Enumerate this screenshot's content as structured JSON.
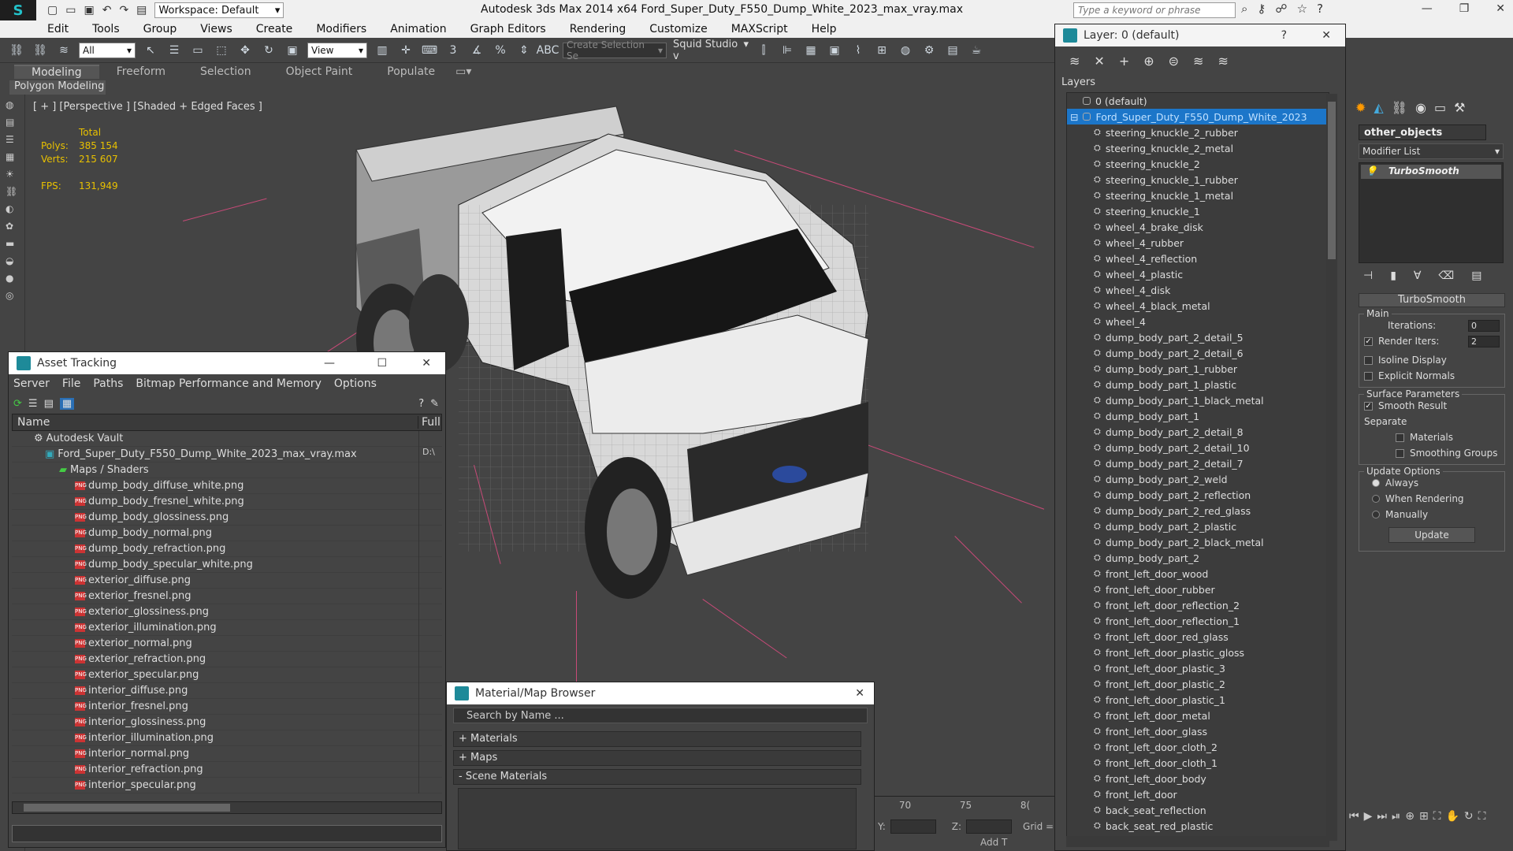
{
  "app": {
    "title": "Autodesk 3ds Max  2014 x64     Ford_Super_Duty_F550_Dump_White_2023_max_vray.max",
    "workspace": "Workspace: Default",
    "search_placeholder": "Type a keyword or phrase"
  },
  "menu": [
    "Edit",
    "Tools",
    "Group",
    "Views",
    "Create",
    "Modifiers",
    "Animation",
    "Graph Editors",
    "Rendering",
    "Customize",
    "MAXScript",
    "Help"
  ],
  "toolbar": {
    "filter": "All",
    "ref_coord": "View",
    "selection_set": "Create Selection Se",
    "squid": "Squid Studio v"
  },
  "ribbon": {
    "tabs": [
      "Modeling",
      "Freeform",
      "Selection",
      "Object Paint",
      "Populate"
    ],
    "active": "Modeling",
    "subpanel": "Polygon Modeling"
  },
  "viewport": {
    "label": "[ + ] [Perspective ] [Shaded + Edged Faces ]",
    "stats": {
      "header": "Total",
      "polys_label": "Polys:",
      "polys": "385 154",
      "verts_label": "Verts:",
      "verts": "215 607",
      "fps_label": "FPS:",
      "fps": "131,949"
    }
  },
  "asset": {
    "title": "Asset Tracking",
    "menu": [
      "Server",
      "File",
      "Paths",
      "Bitmap Performance and Memory",
      "Options"
    ],
    "col_name": "Name",
    "col_full": "Full",
    "vault": "Autodesk Vault",
    "file": "Ford_Super_Duty_F550_Dump_White_2023_max_vray.max",
    "file_path": "D:\\",
    "maps": "Maps / Shaders",
    "textures": [
      "dump_body_diffuse_white.png",
      "dump_body_fresnel_white.png",
      "dump_body_glossiness.png",
      "dump_body_normal.png",
      "dump_body_refraction.png",
      "dump_body_specular_white.png",
      "exterior_diffuse.png",
      "exterior_fresnel.png",
      "exterior_glossiness.png",
      "exterior_illumination.png",
      "exterior_normal.png",
      "exterior_refraction.png",
      "exterior_specular.png",
      "interior_diffuse.png",
      "interior_fresnel.png",
      "interior_glossiness.png",
      "interior_illumination.png",
      "interior_normal.png",
      "interior_refraction.png",
      "interior_specular.png"
    ]
  },
  "layer": {
    "title": "Layer: 0 (default)",
    "header": "Layers",
    "default": "0 (default)",
    "selected": "Ford_Super_Duty_F550_Dump_White_2023",
    "items": [
      "steering_knuckle_2_rubber",
      "steering_knuckle_2_metal",
      "steering_knuckle_2",
      "steering_knuckle_1_rubber",
      "steering_knuckle_1_metal",
      "steering_knuckle_1",
      "wheel_4_brake_disk",
      "wheel_4_rubber",
      "wheel_4_reflection",
      "wheel_4_plastic",
      "wheel_4_disk",
      "wheel_4_black_metal",
      "wheel_4",
      "dump_body_part_2_detail_5",
      "dump_body_part_2_detail_6",
      "dump_body_part_1_rubber",
      "dump_body_part_1_plastic",
      "dump_body_part_1_black_metal",
      "dump_body_part_1",
      "dump_body_part_2_detail_8",
      "dump_body_part_2_detail_10",
      "dump_body_part_2_detail_7",
      "dump_body_part_2_weld",
      "dump_body_part_2_reflection",
      "dump_body_part_2_red_glass",
      "dump_body_part_2_plastic",
      "dump_body_part_2_black_metal",
      "dump_body_part_2",
      "front_left_door_wood",
      "front_left_door_rubber",
      "front_left_door_reflection_2",
      "front_left_door_reflection_1",
      "front_left_door_red_glass",
      "front_left_door_plastic_gloss",
      "front_left_door_plastic_3",
      "front_left_door_plastic_2",
      "front_left_door_plastic_1",
      "front_left_door_metal",
      "front_left_door_glass",
      "front_left_door_cloth_2",
      "front_left_door_cloth_1",
      "front_left_door_body",
      "front_left_door",
      "back_seat_reflection",
      "back_seat_red_plastic"
    ]
  },
  "command": {
    "object_name": "other_objects",
    "modifier_list": "Modifier List",
    "modifier": "TurboSmooth",
    "rollout": "TurboSmooth",
    "main": "Main",
    "iterations_label": "Iterations:",
    "iterations": "0",
    "render_iters_label": "Render Iters:",
    "render_iters": "2",
    "isoline": "Isoline Display",
    "explicit": "Explicit Normals",
    "surface": "Surface Parameters",
    "smooth_result": "Smooth Result",
    "separate": "Separate",
    "materials": "Materials",
    "smoothing_groups": "Smoothing Groups",
    "update_options": "Update Options",
    "always": "Always",
    "when_rendering": "When Rendering",
    "manually": "Manually",
    "update_btn": "Update"
  },
  "material": {
    "title": "Material/Map Browser",
    "search": "Search by Name ...",
    "sections": [
      "+ Materials",
      "+ Maps",
      "- Scene Materials"
    ]
  },
  "timeline": {
    "ticks": [
      "70",
      "75",
      "8("
    ],
    "y_label": "Y:",
    "z_label": "Z:",
    "grid": "Grid =",
    "add": "Add T"
  }
}
